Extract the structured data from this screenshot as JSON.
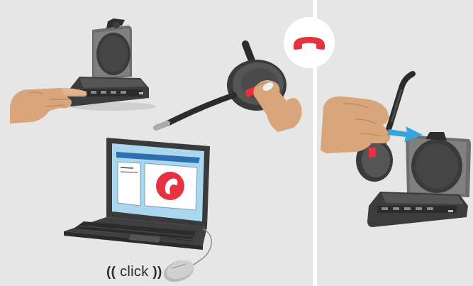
{
  "illustration": {
    "click_label": "click",
    "wave_left": "((",
    "wave_right": "))",
    "icons": {
      "hang_up": "phone-hang-up-icon",
      "arrow": "arrow-right-icon"
    },
    "colors": {
      "panel_bg": "#e6e6e6",
      "accent_red": "#e8313f",
      "device_dark": "#3a3a3a",
      "skin": "#d9a67c",
      "highlight_blue": "#34a6dc"
    }
  }
}
